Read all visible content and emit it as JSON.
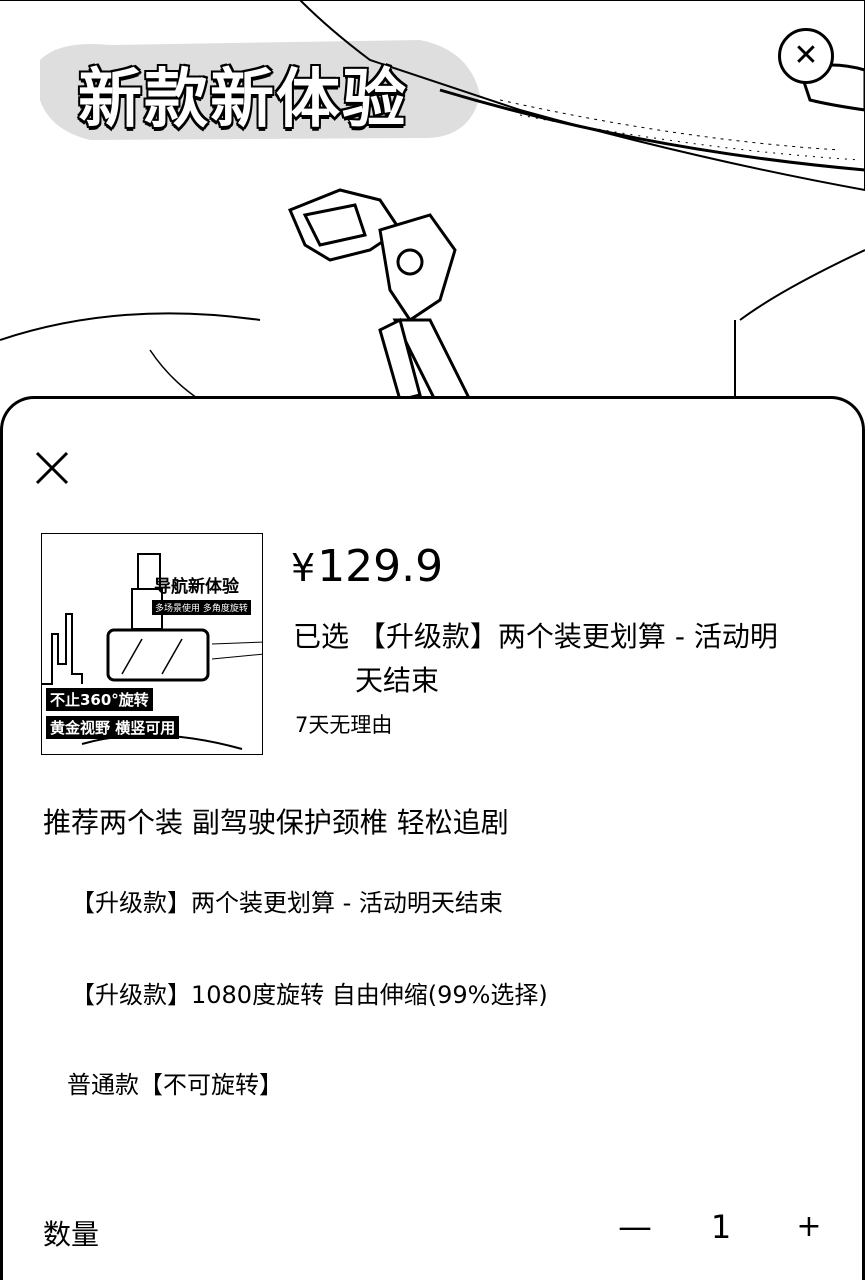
{
  "banner": {
    "title": "新款新体验"
  },
  "product": {
    "thumbnail": {
      "title": "导航新体验",
      "subtitle": "多场景使用 多角度旋转",
      "badge1": "不止360°旋转",
      "badge2": "黄金视野 横竖可用"
    },
    "price_currency": "¥",
    "price_value": "129.9",
    "selected_prefix": "已选",
    "selected_line1": "【升级款】两个装更划算 - 活动明",
    "selected_line2": "天结束",
    "return_policy": "7天无理由"
  },
  "options": {
    "title": "推荐两个装 副驾驶保护颈椎 轻松追剧",
    "items": [
      {
        "label": "【升级款】两个装更划算 - 活动明天结束"
      },
      {
        "label": "【升级款】1080度旋转 自由伸缩(99%选择)"
      },
      {
        "label": "普通款【不可旋转】"
      }
    ]
  },
  "quantity": {
    "label": "数量",
    "minus": "—",
    "value": "1",
    "plus": "+"
  },
  "icons": {
    "close": "close-icon",
    "banner_close": "close-circle-icon"
  }
}
